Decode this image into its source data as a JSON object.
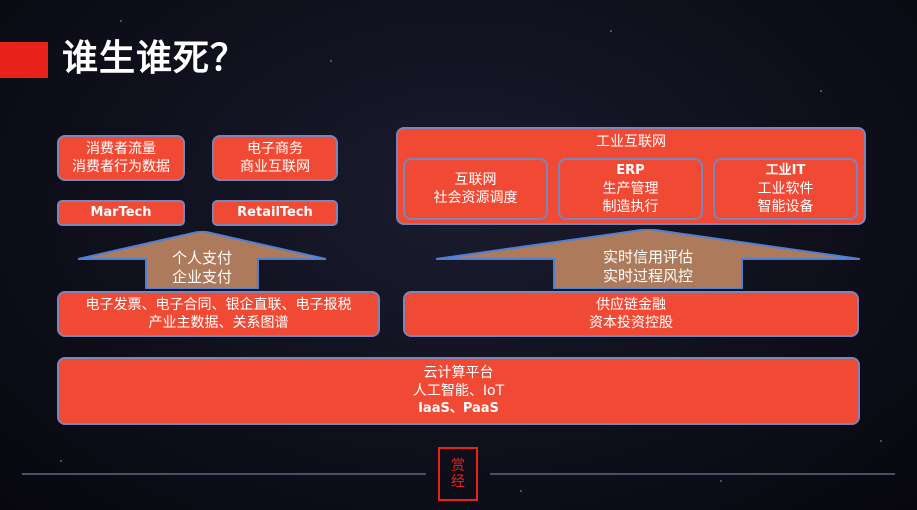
{
  "title": "谁生谁死？",
  "left": {
    "box_consumer": [
      "消费者流量",
      "消费者行为数据"
    ],
    "box_ecommerce": [
      "电子商务",
      "商业互联网"
    ],
    "martech": "MarTech",
    "retailtech": "RetailTech",
    "arrow": [
      "个人支付",
      "企业支付"
    ],
    "bottom": [
      "电子发票、电子合同、银企直联、电子报税",
      "产业主数据、关系图谱"
    ]
  },
  "right": {
    "header": "工业互联网",
    "box_internet": [
      "互联网",
      "社会资源调度"
    ],
    "box_erp": [
      "ERP",
      "生产管理",
      "制造执行"
    ],
    "box_it": [
      "工业IT",
      "工业软件",
      "智能设备"
    ],
    "arrow": [
      "实时信用评估",
      "实时过程风控"
    ],
    "bottom": [
      "供应链金融",
      "资本投资控股"
    ]
  },
  "base": [
    "云计算平台",
    "人工智能、IoT",
    "IaaS、PaaS"
  ],
  "logo": [
    "赏",
    "经"
  ]
}
